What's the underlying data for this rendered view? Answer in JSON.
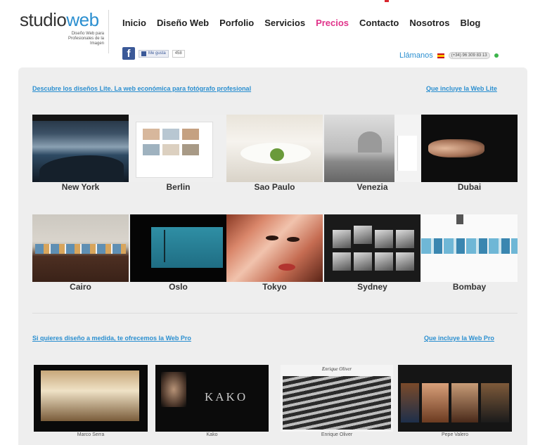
{
  "brand": {
    "name_part1": "studio",
    "name_part2": "web",
    "tagline": "Diseño Web para Profesionales de la Imagen",
    "accent_color": "#2b8fd0"
  },
  "nav": {
    "items": [
      {
        "label": "Inicio",
        "active": false
      },
      {
        "label": "Diseño Web",
        "active": false
      },
      {
        "label": "Porfolio",
        "active": false
      },
      {
        "label": "Servicios",
        "active": false
      },
      {
        "label": "Precios",
        "active": true
      },
      {
        "label": "Contacto",
        "active": false
      },
      {
        "label": "Nosotros",
        "active": false
      },
      {
        "label": "Blog",
        "active": false
      }
    ],
    "active_color": "#e0338a"
  },
  "social": {
    "fb_icon": "f",
    "like_label": "Me gusta",
    "like_count": "458"
  },
  "call": {
    "label": "Llámanos",
    "phone": "(+34) 96 309 83 13",
    "flag_icon": "spain-flag-icon",
    "status_icon": "online-dot-icon"
  },
  "lite": {
    "intro": "Descubre los diseños Lite. La web económica para fotógrafo profesional",
    "includes_link": "Que incluye la Web Lite",
    "designs": [
      {
        "name": "New York"
      },
      {
        "name": "Berlin"
      },
      {
        "name": "Sao Paulo"
      },
      {
        "name": "Venezia"
      },
      {
        "name": "Dubai"
      },
      {
        "name": "Cairo"
      },
      {
        "name": "Oslo"
      },
      {
        "name": "Tokyo"
      },
      {
        "name": "Sydney"
      },
      {
        "name": "Bombay"
      }
    ]
  },
  "pro": {
    "intro": "Si quieres diseño a medida, te ofrecemos la Web Pro",
    "includes_link": "Que incluye la Web Pro",
    "clients": [
      {
        "name": "Marco Serra"
      },
      {
        "name": "Kako",
        "logo_text": "KAKO"
      },
      {
        "name": "Enrique Oliver",
        "logo_text": "Enrique Oliver"
      },
      {
        "name": "Pepe Valero"
      }
    ]
  }
}
